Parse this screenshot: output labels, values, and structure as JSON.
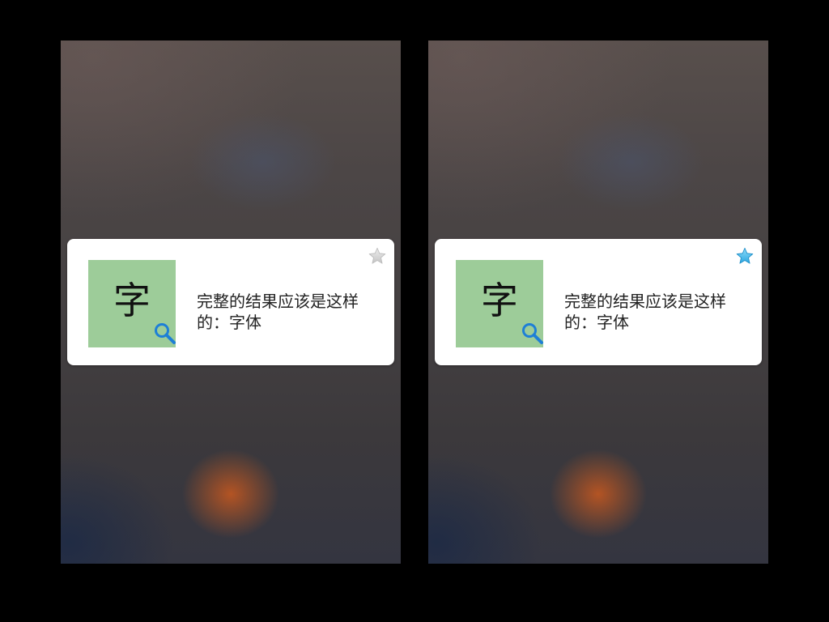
{
  "screens": [
    {
      "card": {
        "character": "字",
        "result_text": "完整的结果应该是这样的：字体",
        "favorite_icon": "star-outline-icon",
        "favorite_state": "unstarred",
        "star_color": "#d6d6d6",
        "thumb_icon": "magnifier-icon"
      }
    },
    {
      "card": {
        "character": "字",
        "result_text": "完整的结果应该是这样的：字体",
        "favorite_icon": "star-filled-icon",
        "favorite_state": "starred",
        "star_color": "#3fb6e8",
        "thumb_icon": "magnifier-icon"
      }
    }
  ],
  "colors": {
    "thumb_bg": "#9dcc99",
    "magnifier": "#1e7fd6",
    "card_bg": "#ffffff"
  }
}
